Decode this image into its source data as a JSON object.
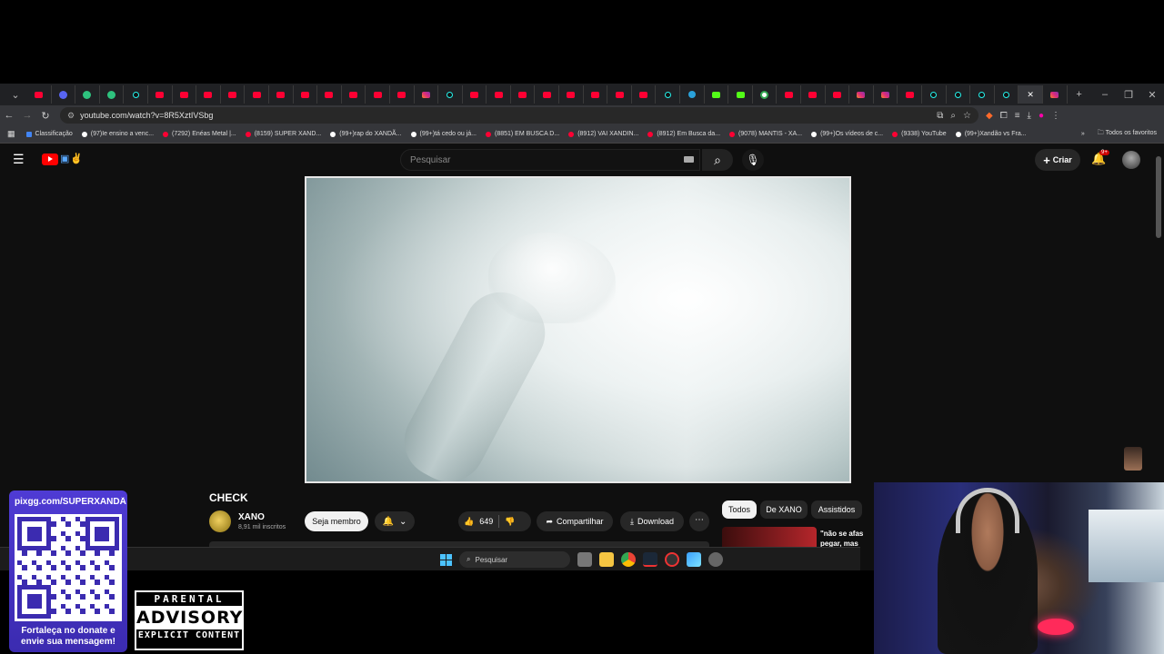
{
  "browser": {
    "tab_favicons": [
      "youtube",
      "discord",
      "green",
      "green",
      "tiktok",
      "youtube",
      "youtube",
      "youtube",
      "youtube",
      "youtube",
      "youtube",
      "youtube",
      "youtube",
      "youtube",
      "youtube",
      "youtube",
      "instagram",
      "tiktok",
      "youtube",
      "youtube",
      "youtube",
      "youtube",
      "youtube",
      "youtube",
      "youtube",
      "youtube",
      "tiktok",
      "telegram",
      "kick",
      "kick",
      "google",
      "youtube",
      "youtube",
      "youtube",
      "instagram",
      "instagram",
      "youtube",
      "tiktok",
      "tiktok",
      "tiktok",
      "tiktok",
      "youtube",
      "instagram"
    ],
    "active_tab_index": 41,
    "url": "youtube.com/watch?v=8R5XztIVSbg",
    "bookmarks": [
      {
        "label": "Classificação",
        "icon": "globe"
      },
      {
        "label": "(97)Ie ensino a venc...",
        "icon": "tiktok"
      },
      {
        "label": "(7292) Enéas Metal |...",
        "icon": "youtube"
      },
      {
        "label": "(8159) SUPER XAND...",
        "icon": "youtube"
      },
      {
        "label": "(99+)rap do XANDÃ...",
        "icon": "tiktok"
      },
      {
        "label": "(99+)tá cedo ou já...",
        "icon": "tiktok"
      },
      {
        "label": "(8851) EM BUSCA D...",
        "icon": "youtube"
      },
      {
        "label": "(8912) VAI XANDIN...",
        "icon": "youtube"
      },
      {
        "label": "(8912) Em Busca da...",
        "icon": "youtube"
      },
      {
        "label": "(9078) MANTIS - XA...",
        "icon": "youtube"
      },
      {
        "label": "(99+)Os vídeos de c...",
        "icon": "tiktok"
      },
      {
        "label": "(9338) YouTube",
        "icon": "youtube"
      },
      {
        "label": "(99+)Xandão vs Fra...",
        "icon": "tiktok"
      }
    ],
    "all_favorites": "Todos os favoritos"
  },
  "youtube": {
    "search_placeholder": "Pesquisar",
    "create_label": "Criar",
    "notification_count": "9+",
    "video_title": "CHECK",
    "channel_name": "XANO",
    "subscribers": "8,91 mil inscritos",
    "join_label": "Seja membro",
    "like_count": "649",
    "share_label": "Compartilhar",
    "download_label": "Download",
    "chips": [
      "Todos",
      "De XANO",
      "Assistidos"
    ],
    "rec_title": "\"não se afas pegar, mas"
  },
  "taskbar": {
    "search_label": "Pesquisar"
  },
  "overlay": {
    "donate_url": "pixgg.com/SUPERXANDÃ",
    "donate_message": "Fortaleça no donate e envie sua mensagem!",
    "advisory_top": "PARENTAL",
    "advisory_mid": "ADVISORY",
    "advisory_bottom": "EXPLICIT CONTENT"
  },
  "colors": {
    "youtube_red": "#ff0000",
    "donate_panel": "#4f3bd4",
    "windows_accent": "#4cc2ff"
  }
}
